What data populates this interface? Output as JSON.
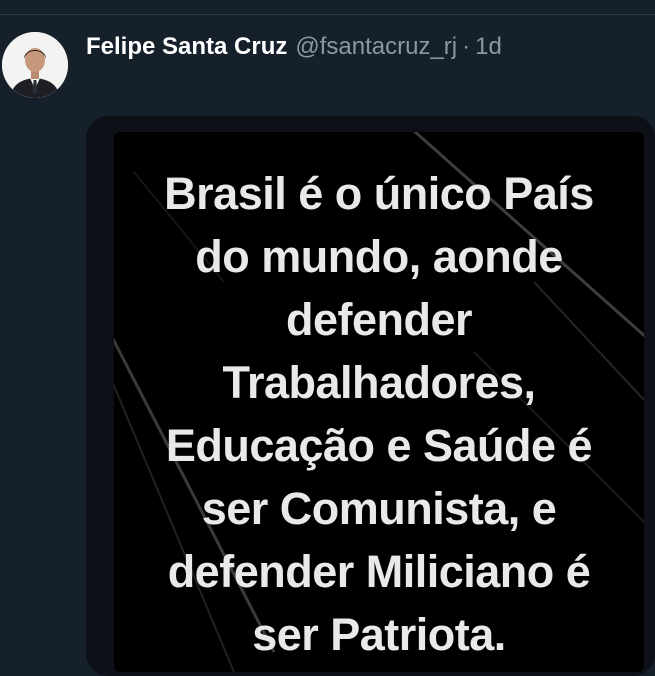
{
  "tweet": {
    "display_name": "Felipe Santa Cruz",
    "handle": "@fsantacruz_rj",
    "separator": "·",
    "time": "1d",
    "avatar_icon": "person-photo-icon",
    "image": {
      "lines": [
        "Brasil é o único País",
        "do mundo, aonde",
        "defender",
        "Trabalhadores,",
        "Educação e Saúde é",
        "ser Comunista, e",
        "defender Miliciano é",
        "ser Patriota."
      ],
      "text_color": "#e9e9e9",
      "background": "#000000"
    }
  },
  "theme": {
    "background": "#15202b",
    "name_color": "#ffffff",
    "muted_color": "#8899a6"
  }
}
